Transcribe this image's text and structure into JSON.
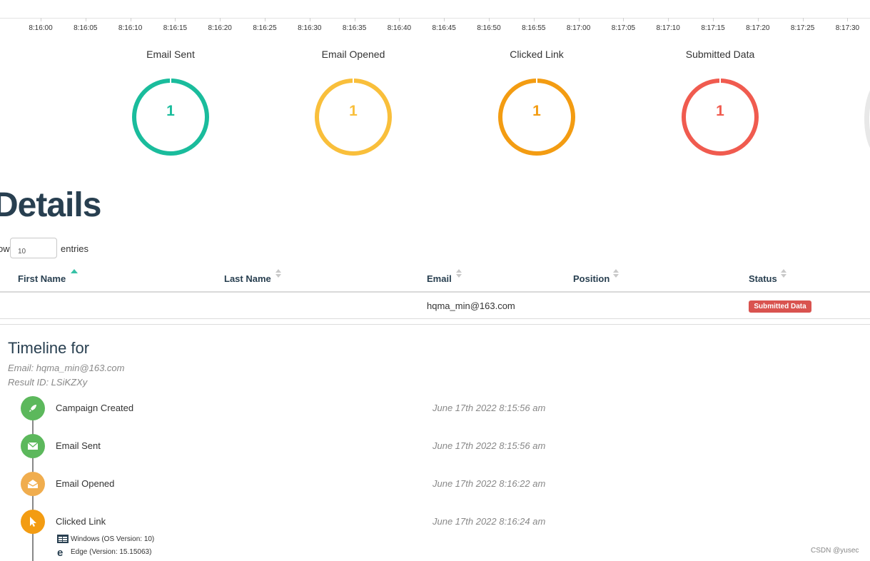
{
  "time_axis": {
    "ticks": [
      "8:16:00",
      "8:16:05",
      "8:16:10",
      "8:16:15",
      "8:16:20",
      "8:16:25",
      "8:16:30",
      "8:16:35",
      "8:16:40",
      "8:16:45",
      "8:16:50",
      "8:16:55",
      "8:17:00",
      "8:17:05",
      "8:17:10",
      "8:17:15",
      "8:17:20",
      "8:17:25",
      "8:17:30"
    ]
  },
  "stats": [
    {
      "title": "Email Sent",
      "value": "1",
      "color": "#1abc9c"
    },
    {
      "title": "Email Opened",
      "value": "1",
      "color": "#f9bf3b"
    },
    {
      "title": "Clicked Link",
      "value": "1",
      "color": "#f39c12"
    },
    {
      "title": "Submitted Data",
      "value": "1",
      "color": "#f05b4f"
    }
  ],
  "details": {
    "title": "Details",
    "show_label": "ow",
    "entries_value": "10",
    "entries_label": "entries",
    "columns": [
      "First Name",
      "Last Name",
      "Email",
      "Position",
      "Status"
    ],
    "rows": [
      {
        "first_name": "",
        "last_name": "",
        "email": "hqma_min@163.com",
        "position": "",
        "status": "Submitted Data",
        "status_color": "#d9534f"
      }
    ]
  },
  "timeline": {
    "title": "Timeline for",
    "email_line": "Email: hqma_min@163.com",
    "result_line": "Result ID: LSiKZXy",
    "events": [
      {
        "message": "Campaign Created",
        "date": "June 17th 2022 8:15:56 am",
        "icon": "rocket-icon",
        "color": "#5cb85c"
      },
      {
        "message": "Email Sent",
        "date": "June 17th 2022 8:15:56 am",
        "icon": "envelope-icon",
        "color": "#5cb85c"
      },
      {
        "message": "Email Opened",
        "date": "June 17th 2022 8:16:22 am",
        "icon": "envelope-open-icon",
        "color": "#f0ad4e"
      },
      {
        "message": "Clicked Link",
        "date": "June 17th 2022 8:16:24 am",
        "icon": "mouse-pointer-icon",
        "color": "#f39c12"
      }
    ],
    "click_details": {
      "os": "Windows (OS Version: 10)",
      "browser": "Edge (Version: 15.15063)"
    }
  },
  "watermark": "CSDN @yusec"
}
